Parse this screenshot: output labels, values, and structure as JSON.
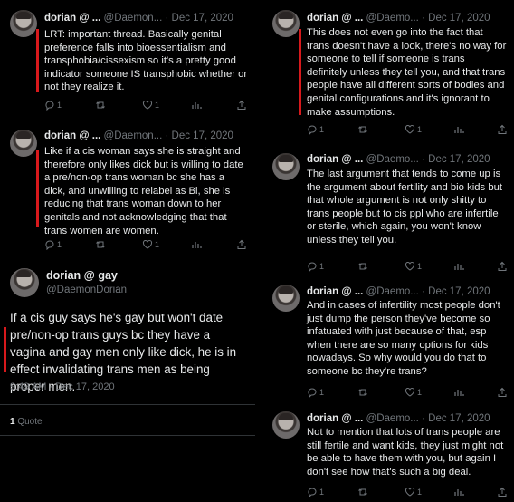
{
  "left_tweets": [
    {
      "name": "dorian @ ...",
      "handle": "@Daemon...",
      "date": "Dec 17, 2020",
      "text": "LRT: important thread. Basically genital preference falls into bioessentialism and transphobia/cissexism so it's a pretty good indicator someone IS transphobic whether or not they realize it.",
      "reply_count": "1",
      "like_count": "1"
    },
    {
      "name": "dorian @ ...",
      "handle": "@Daemon...",
      "date": "Dec 17, 2020",
      "text": "Like if a cis woman says she is straight and therefore only likes dick but is willing to date a pre/non-op trans woman bc she has a dick, and unwilling to relabel as Bi, she is reducing that trans woman down to her genitals and not acknowledging that that trans women are women.",
      "reply_count": "1",
      "like_count": "1"
    }
  ],
  "main_tweet": {
    "name": "dorian @ gay",
    "handle": "@DaemonDorian",
    "text": "If a cis guy says he's gay but won't date pre/non-op trans guys bc they have a vagina and gay men only like dick, he is in effect invalidating trans men as being proper men.",
    "timestamp": "9:49 AM · Dec 17, 2020",
    "quote_count": "1",
    "quote_label": "Quote"
  },
  "right_tweets": [
    {
      "name": "dorian @ ...",
      "handle": "@Daemo...",
      "date": "Dec 17, 2020",
      "text": "This does not even go into the fact that trans doesn't have a look, there's no way for someone to tell if someone is trans definitely unless they tell you, and that trans people have all different sorts of bodies and genital configurations and it's ignorant to make assumptions.",
      "reply_count": "1",
      "like_count": "1"
    },
    {
      "name": "dorian @ ...",
      "handle": "@Daemo...",
      "date": "Dec 17, 2020",
      "text": "The last argument that tends to come up is the argument about fertility and bio kids but that whole argument is not only shitty to trans people but to cis ppl who are infertile or sterile, which again, you won't know unless they tell you.",
      "reply_count": "1",
      "like_count": "1"
    },
    {
      "name": "dorian @ ...",
      "handle": "@Daemo...",
      "date": "Dec 17, 2020",
      "text": "And in cases of infertility most people don't just dump the person they've become so infatuated with just because of that, esp when there are so many options for kids nowadays. So why would you do that to someone bc they're trans?",
      "reply_count": "1",
      "like_count": "1"
    },
    {
      "name": "dorian @ ...",
      "handle": "@Daemo...",
      "date": "Dec 17, 2020",
      "text": "Not to mention that lots of trans people are still fertile and want kids, they just might not be able to have them with you, but again I don't see how that's such a big deal.",
      "reply_count": "1",
      "like_count": "1"
    }
  ],
  "colors": {
    "accent_red": "#d7191c",
    "muted": "#71767b",
    "text": "#e7e9ea",
    "background": "#000000"
  },
  "icons": [
    "reply-icon",
    "retweet-icon",
    "like-icon",
    "share-icon"
  ]
}
